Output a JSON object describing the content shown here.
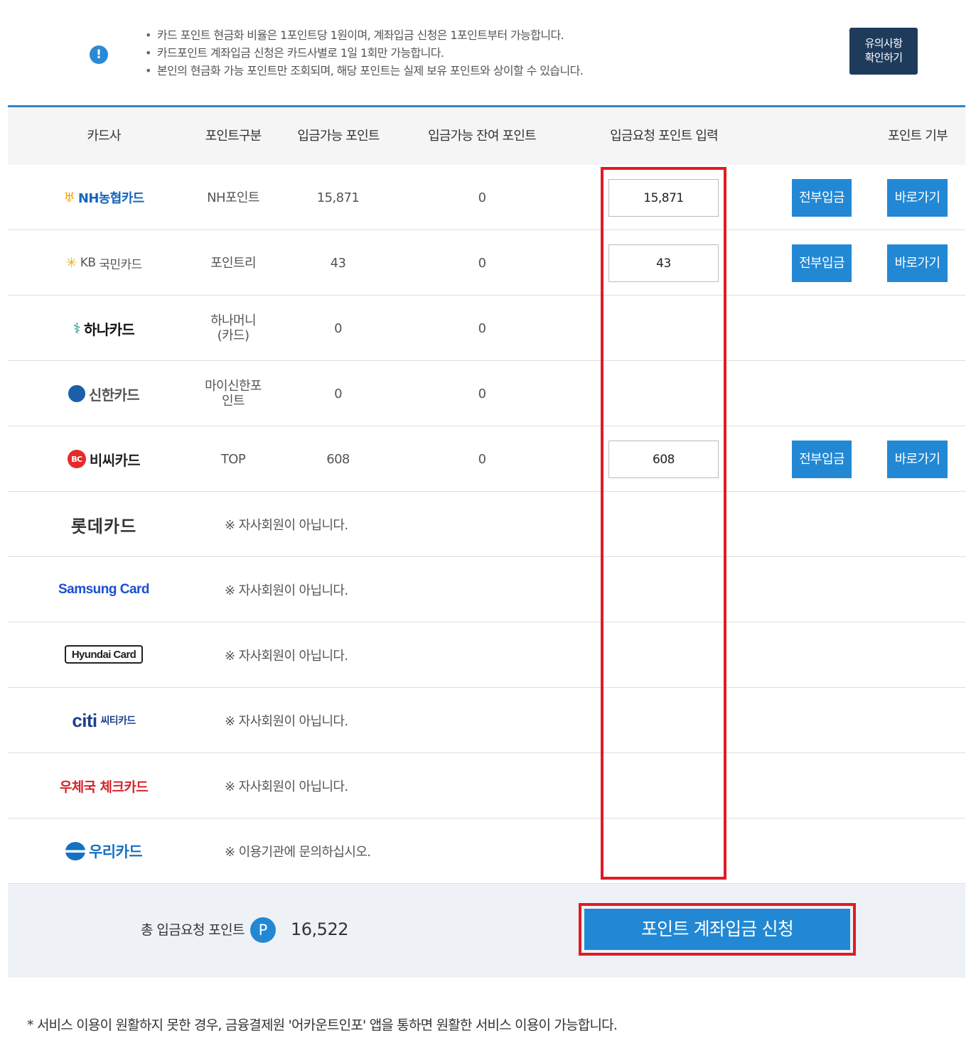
{
  "notice": {
    "icon": "info-icon",
    "items": [
      "카드 포인트 현금화 비율은 1포인트당 1원이며, 계좌입금 신청은 1포인트부터 가능합니다.",
      "카드포인트 계좌입금 신청은 카드사별로 1일 1회만 가능합니다.",
      "본인의 현금화 가능 포인트만 조회되며, 해당 포인트는 실제 보유 포인트와 상이할 수 있습니다."
    ],
    "button_line1": "유의사항",
    "button_line2": "확인하기"
  },
  "table": {
    "headers": {
      "card": "카드사",
      "type": "포인트구분",
      "available": "입금가능 포인트",
      "remaining": "입금가능 잔여 포인트",
      "request": "입금요청 포인트 입력",
      "donate": "포인트 기부"
    },
    "rows": [
      {
        "brand_mark": "NH",
        "brand_text": "NH농협카드",
        "type": "NH포인트",
        "available": "15,871",
        "remaining": "0",
        "input": "15,871",
        "btn_all": "전부입금",
        "btn_go": "바로가기"
      },
      {
        "brand_mark": "KB",
        "brand_text": "국민카드",
        "type": "포인트리",
        "available": "43",
        "remaining": "0",
        "input": "43",
        "btn_all": "전부입금",
        "btn_go": "바로가기"
      },
      {
        "brand_text": "하나카드",
        "type_line1": "하나머니",
        "type_line2": "(카드)",
        "available": "0",
        "remaining": "0"
      },
      {
        "brand_text": "신한카드",
        "type_line1": "마이신한포",
        "type_line2": "인트",
        "available": "0",
        "remaining": "0"
      },
      {
        "brand_mark": "BC",
        "brand_text": "비씨카드",
        "type": "TOP",
        "available": "608",
        "remaining": "0",
        "input": "608",
        "btn_all": "전부입금",
        "btn_go": "바로가기"
      },
      {
        "brand_text": "롯데카드",
        "message": "※ 자사회원이 아닙니다."
      },
      {
        "brand_text": "Samsung Card",
        "message": "※ 자사회원이 아닙니다."
      },
      {
        "brand_text": "Hyundai Card",
        "message": "※ 자사회원이 아닙니다."
      },
      {
        "brand_mark": "citi",
        "brand_text": "씨티카드",
        "message": "※ 자사회원이 아닙니다."
      },
      {
        "brand_text": "우체국 체크카드",
        "message": "※ 자사회원이 아닙니다."
      },
      {
        "brand_text": "우리카드",
        "message": "※ 이용기관에 문의하십시오."
      }
    ]
  },
  "summary": {
    "label": "총 입금요청 포인트",
    "p_badge": "P",
    "value": "16,522",
    "submit": "포인트 계좌입금 신청"
  },
  "footer_note": "* 서비스 이용이 원활하지 못한 경우, 금융결제원 '어카운트인포' 앱을 통하면 원활한 서비스 이용이 가능합니다.",
  "colors": {
    "accent": "#2288d4",
    "notice_btn": "#1f3b5c",
    "highlight": "#e01b24"
  }
}
